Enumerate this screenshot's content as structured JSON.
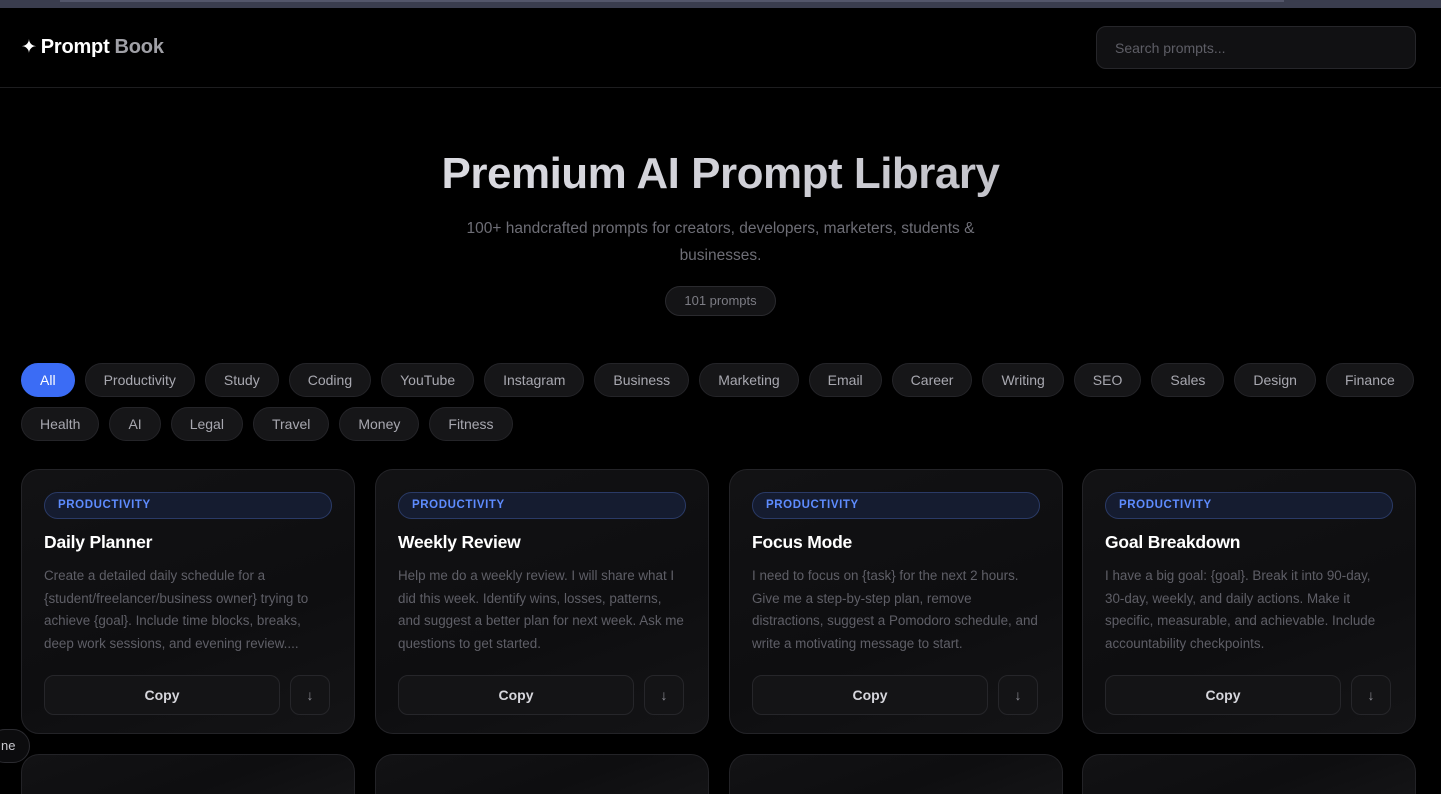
{
  "header": {
    "logo_icon": "sparkle-icon",
    "logo_word1": "Prompt",
    "logo_word2": "Book",
    "search_placeholder": "Search prompts..."
  },
  "hero": {
    "title": "Premium AI Prompt Library",
    "subtitle": "100+ handcrafted prompts for creators, developers, marketers, students & businesses.",
    "count_label": "101 prompts"
  },
  "filters": {
    "active": "All",
    "row1": [
      "All",
      "Productivity",
      "Study",
      "Coding",
      "YouTube",
      "Instagram",
      "Business",
      "Marketing",
      "Email",
      "Career",
      "Writing",
      "SEO",
      "Sales",
      "Design",
      "Finance"
    ],
    "row2": [
      "Health",
      "AI",
      "Legal",
      "Travel",
      "Money",
      "Fitness"
    ]
  },
  "cards": [
    {
      "category": "PRODUCTIVITY",
      "title": "Daily Planner",
      "description": "Create a detailed daily schedule for a {student/freelancer/business owner} trying to achieve {goal}. Include time blocks, breaks, deep work sessions, and evening review....",
      "copy_label": "Copy",
      "download_icon": "arrow-down-icon"
    },
    {
      "category": "PRODUCTIVITY",
      "title": "Weekly Review",
      "description": "Help me do a weekly review. I will share what I did this week. Identify wins, losses, patterns, and suggest a better plan for next week. Ask me questions to get started.",
      "copy_label": "Copy",
      "download_icon": "arrow-down-icon"
    },
    {
      "category": "PRODUCTIVITY",
      "title": "Focus Mode",
      "description": "I need to focus on {task} for the next 2 hours. Give me a step-by-step plan, remove distractions, suggest a Pomodoro schedule, and write a motivating message to start.",
      "copy_label": "Copy",
      "download_icon": "arrow-down-icon"
    },
    {
      "category": "PRODUCTIVITY",
      "title": "Goal Breakdown",
      "description": "I have a big goal: {goal}. Break it into 90-day, 30-day, weekly, and daily actions. Make it specific, measurable, and achievable. Include accountability checkpoints.",
      "copy_label": "Copy",
      "download_icon": "arrow-down-icon"
    }
  ],
  "floating_button": {
    "label": "ne"
  },
  "colors": {
    "accent": "#3b6cf5",
    "badge_text": "#5e8cff",
    "background": "#000000"
  }
}
